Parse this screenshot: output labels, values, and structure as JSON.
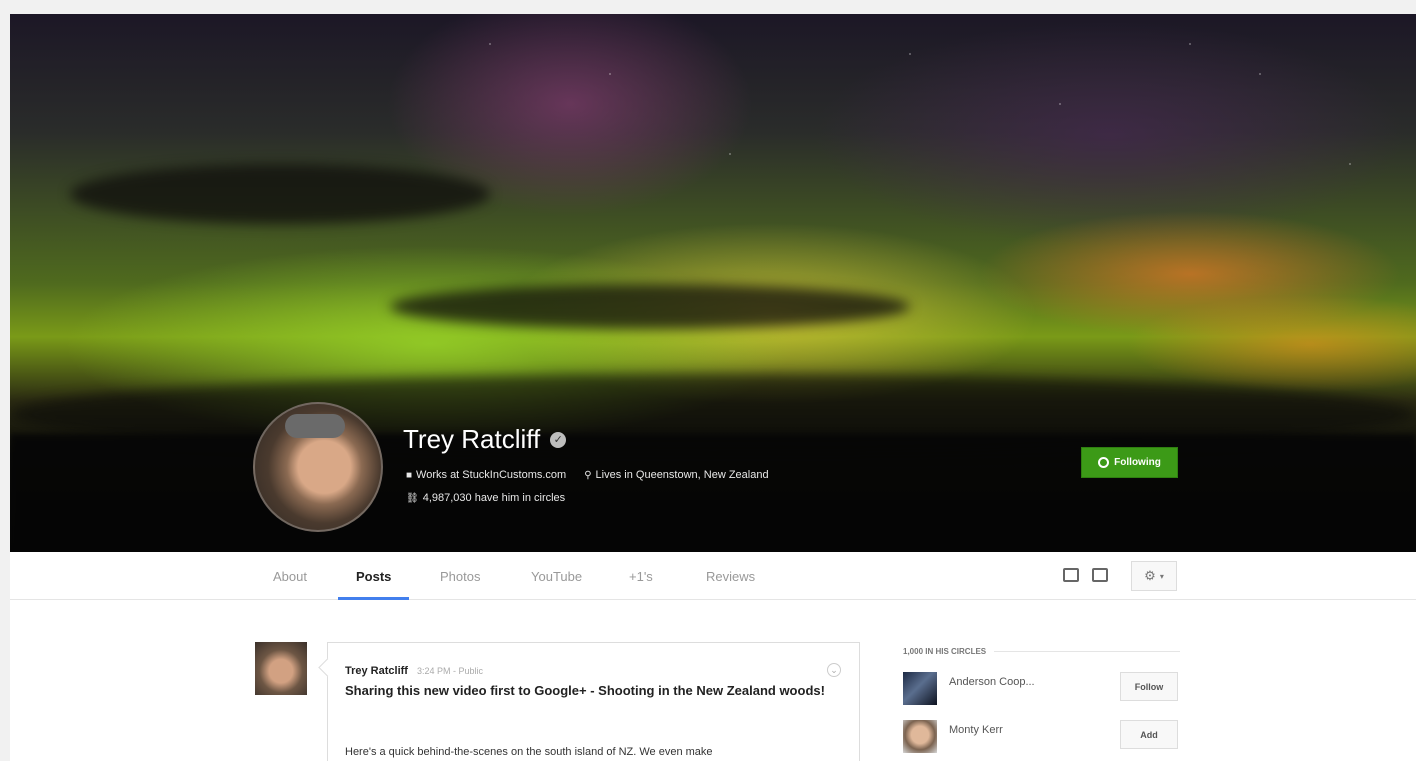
{
  "profile": {
    "name": "Trey Ratcliff",
    "works_at": "Works at StuckInCustoms.com",
    "lives_in": "Lives in Queenstown, New Zealand",
    "circles_count": "4,987,030 have him in circles",
    "follow_label": "Following"
  },
  "tabs": [
    {
      "label": "About"
    },
    {
      "label": "Posts"
    },
    {
      "label": "Photos"
    },
    {
      "label": "YouTube"
    },
    {
      "label": "+1's"
    },
    {
      "label": "Reviews"
    }
  ],
  "post": {
    "author": "Trey Ratcliff",
    "time": "3:24 PM - Public",
    "title": "Sharing this new video first to Google+ - Shooting in the New Zealand woods!",
    "body": "Here's a quick behind-the-scenes on the south island of NZ. We even make"
  },
  "sidebar": {
    "circles_heading": "1,000 IN HIS CIRCLES",
    "people": [
      {
        "name": "Anderson Coop...",
        "action": "Follow"
      },
      {
        "name": "Monty Kerr",
        "action": "Add"
      }
    ]
  },
  "colors": {
    "accent": "#3c9a17",
    "tab_underline": "#427fed"
  }
}
